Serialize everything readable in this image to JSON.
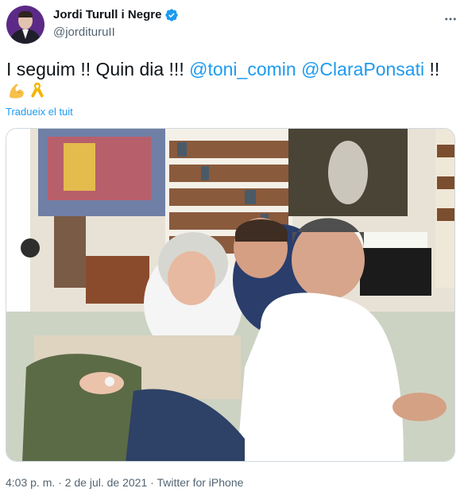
{
  "author": {
    "name": "Jordi Turull i Negre",
    "handle": "@jordituruII",
    "verified_icon": "verified-badge-icon",
    "avatar_icon": "profile-avatar"
  },
  "menu_icon": "more-options-icon",
  "tweet": {
    "text_start": "I seguim !! Quin dia !!! ",
    "mention_1": "@toni_comin",
    "mention_2": "@ClaraPonsati",
    "text_end": " !!",
    "emojis": [
      "flexed-biceps-emoji",
      "yellow-ribbon-emoji"
    ],
    "translate_link": "Tradueix el tuit"
  },
  "media": {
    "icon": "tweet-photo"
  },
  "footer": {
    "time": "4:03 p. m.",
    "separator": " · ",
    "date": "2 de jul. de 2021",
    "source": "Twitter for iPhone"
  },
  "colors": {
    "text": "#0f1419",
    "secondary": "#536471",
    "link": "#1d9bf0"
  }
}
